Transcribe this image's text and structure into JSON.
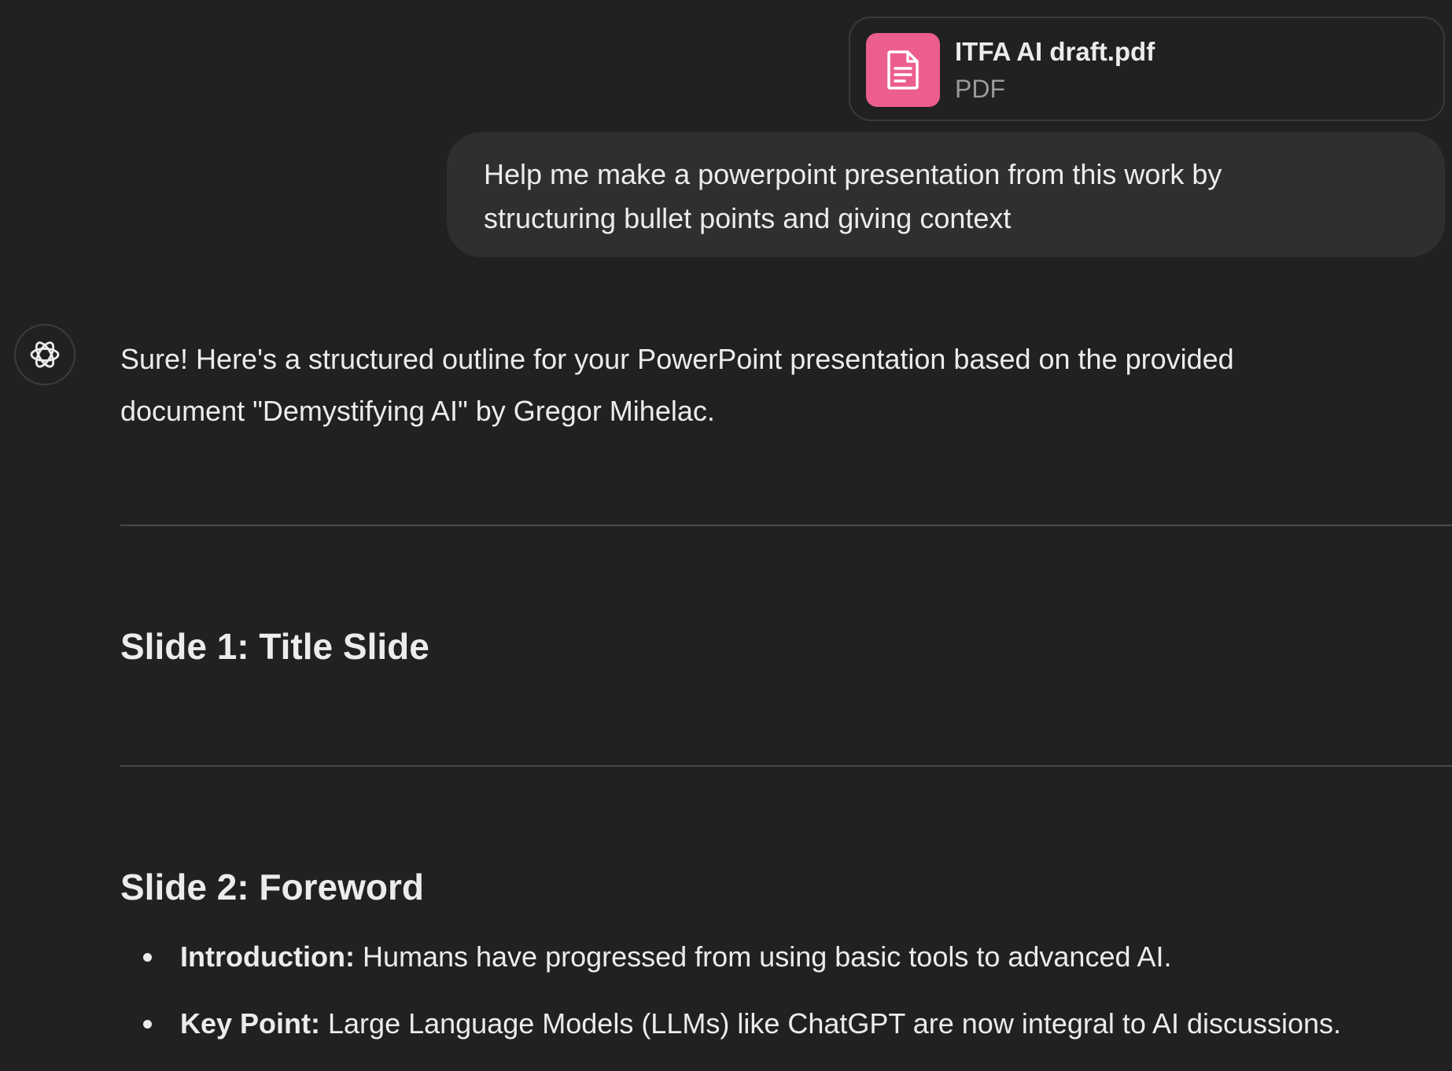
{
  "attachment": {
    "file_name": "ITFA AI draft.pdf",
    "file_type": "PDF",
    "icon": "document-icon",
    "icon_bg_color": "#ec5e8d"
  },
  "user_message": {
    "line_1": "Help me make a powerpoint presentation from this work by",
    "line_2": "structuring bullet points and giving context"
  },
  "assistant": {
    "avatar_icon": "openai-logo-icon",
    "intro_line_1": "Sure! Here's a structured outline for your PowerPoint presentation based on the provided",
    "intro_line_2": "document \"Demystifying AI\" by Gregor Mihelac.",
    "slide_1_heading": "Slide 1: Title Slide",
    "slide_2_heading": "Slide 2: Foreword",
    "slide_2_bullets": [
      {
        "key": "Introduction:",
        "text": " Humans have progressed from using basic tools to advanced AI."
      },
      {
        "key": "Key Point:",
        "text": " Large Language Models (LLMs) like ChatGPT are now integral to AI discussions."
      }
    ]
  }
}
